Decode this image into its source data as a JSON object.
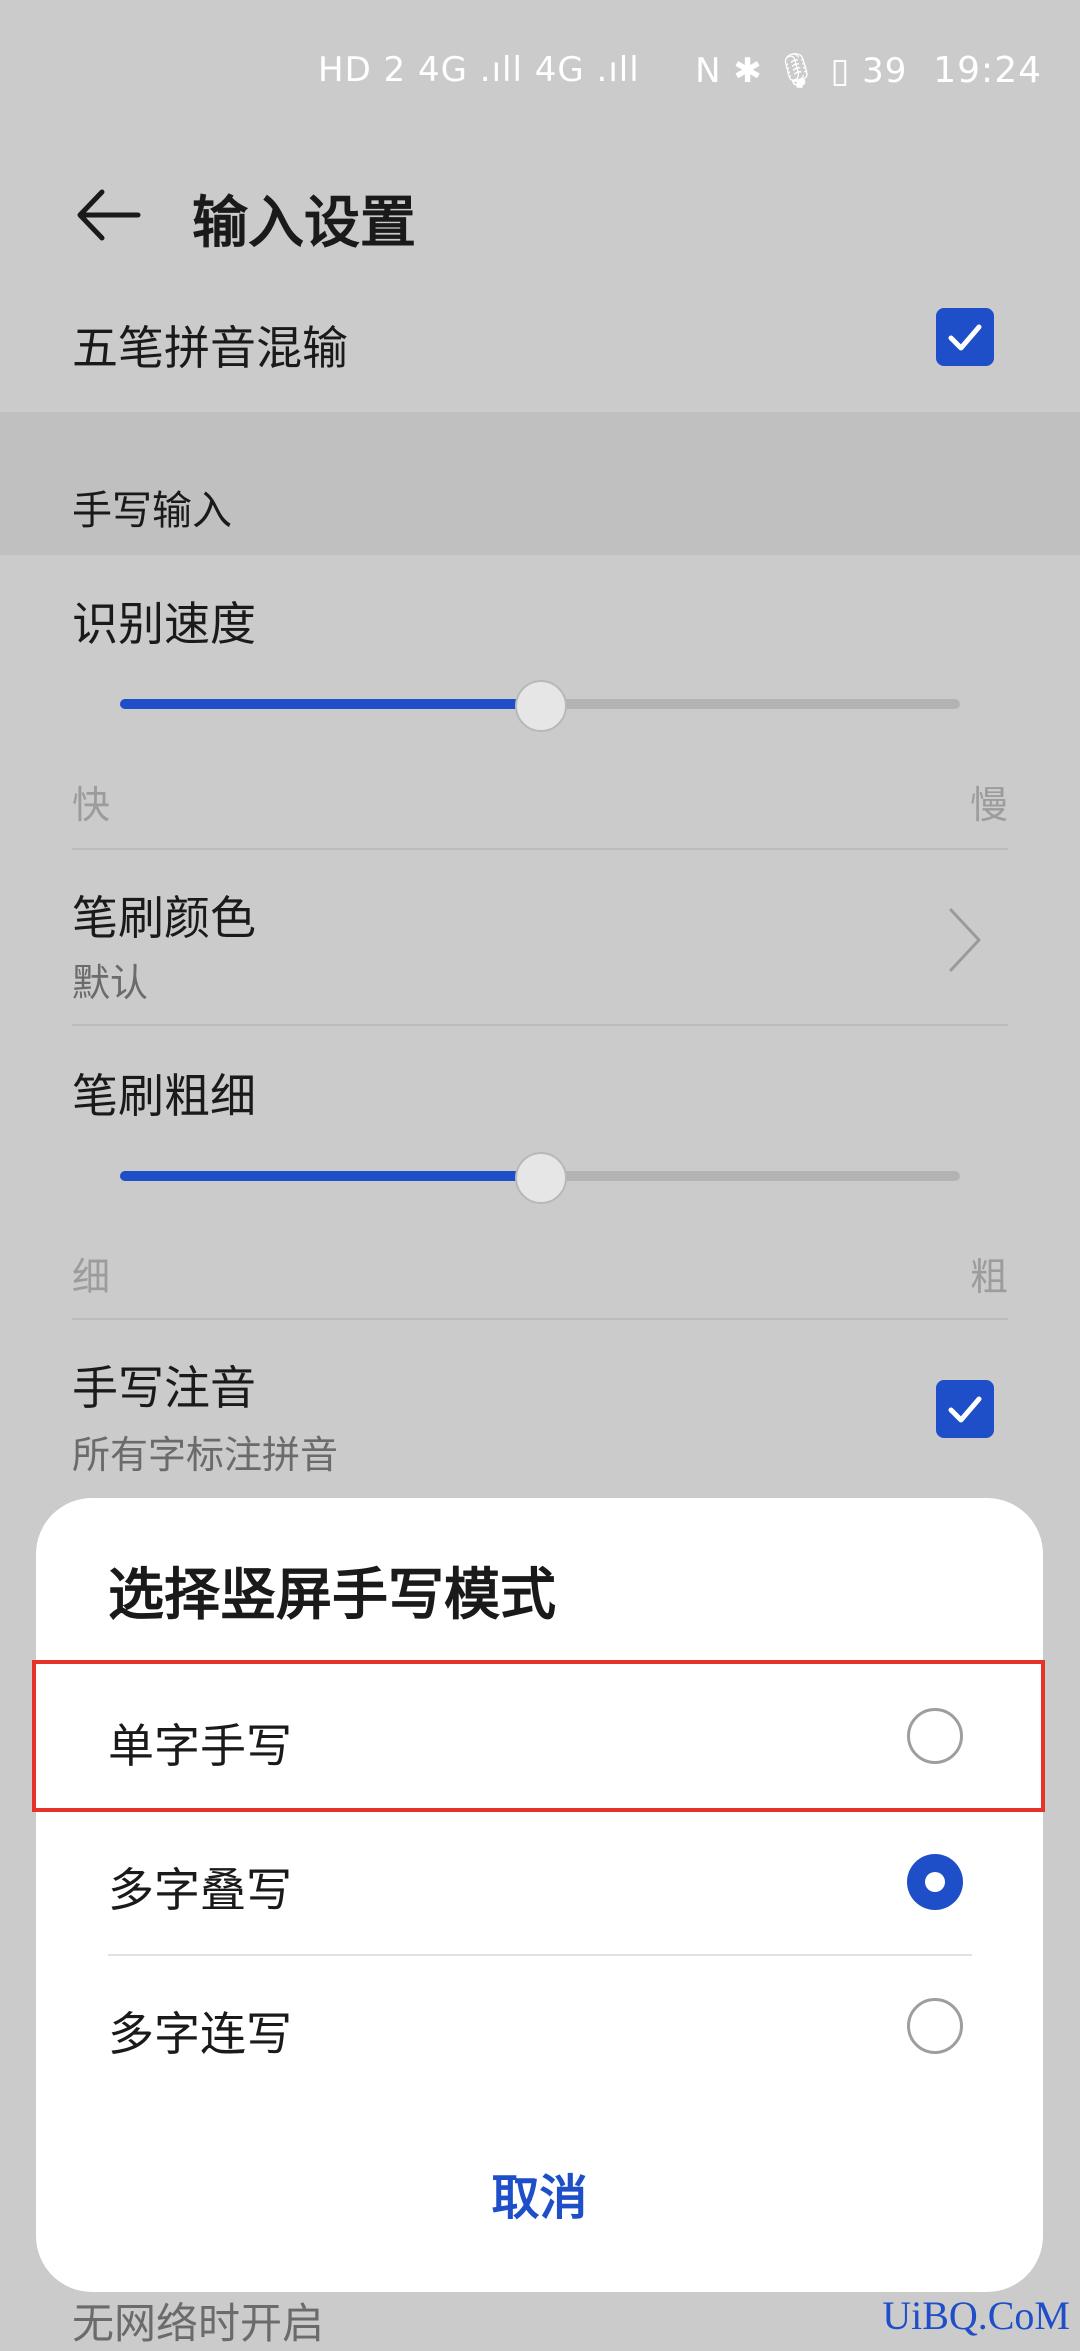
{
  "status_bar": {
    "left_indicators": "HD 2 4G .ıll 4G .ıll",
    "right_indicators": "N ✱ 🎙 ▯ 39",
    "time": "19:24"
  },
  "header": {
    "title": "输入设置"
  },
  "rows": {
    "wubi_pinyin": {
      "label": "五笔拼音混输",
      "checked": true
    },
    "section_handwriting": "手写输入",
    "recognition_speed": {
      "label": "识别速度",
      "min_label": "快",
      "max_label": "慢",
      "value": 0.5
    },
    "brush_color": {
      "label": "笔刷颜色",
      "value": "默认"
    },
    "brush_thickness": {
      "label": "笔刷粗细",
      "min_label": "细",
      "max_label": "粗",
      "value": 0.5
    },
    "handwriting_pinyin": {
      "label": "手写注音",
      "sub": "所有字标注拼音",
      "checked": true
    }
  },
  "dialog": {
    "title": "选择竖屏手写模式",
    "options": [
      {
        "label": "单字手写",
        "selected": false
      },
      {
        "label": "多字叠写",
        "selected": true
      },
      {
        "label": "多字连写",
        "selected": false
      }
    ],
    "cancel": "取消"
  },
  "background_peek": "无网络时开启",
  "watermark": "UiBQ.CoM",
  "colors": {
    "accent": "#1f4ec9",
    "highlight": "#e5332a"
  }
}
